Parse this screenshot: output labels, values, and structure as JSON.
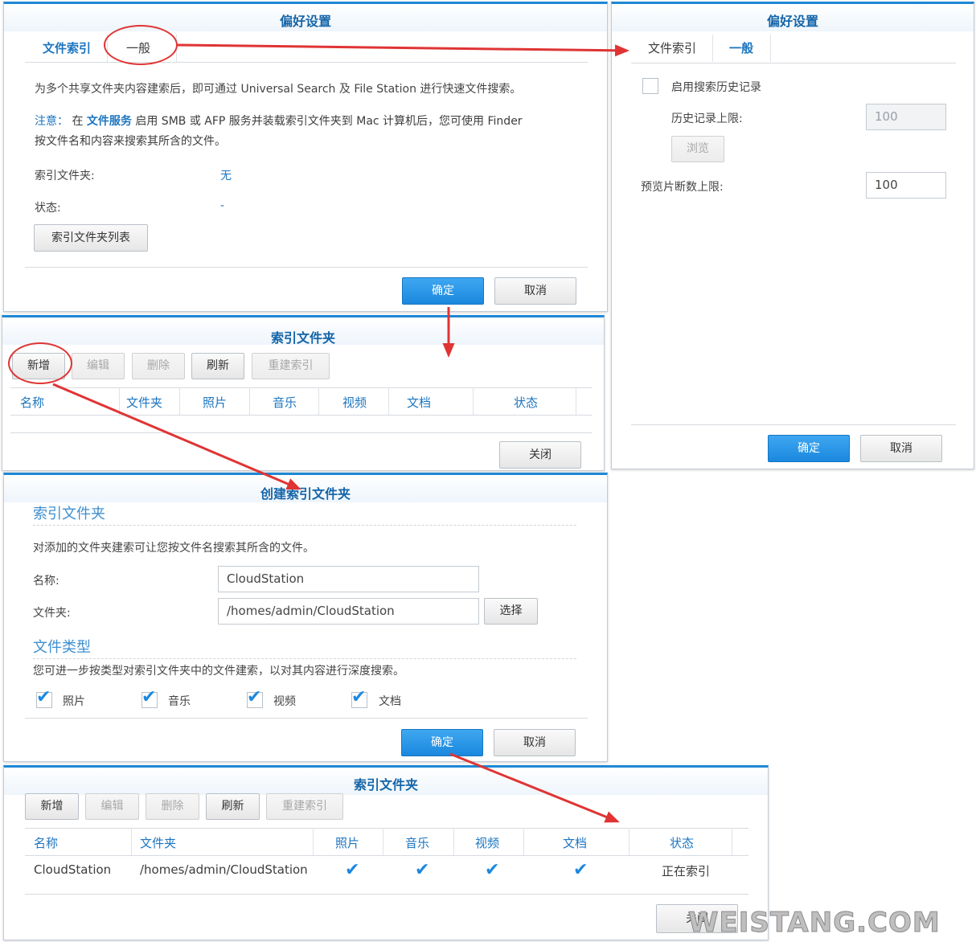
{
  "pref_window": {
    "title": "偏好设置",
    "tabs": [
      "文件索引",
      "一般"
    ],
    "intro": "为多个共享文件夹内容建索后，即可通过 Universal Search 及 File Station 进行快速文件搜索。",
    "note_label": "注意：",
    "note_in": "在",
    "note_link": "文件服务",
    "note_text1": "启用 SMB 或 AFP 服务并装载索引文件夹到 Mac 计算机后，您可使用 Finder",
    "note_text2": "按文件名和内容来搜索其所含的文件。",
    "index_folder_label": "索引文件夹:",
    "index_folder_value": "无",
    "status_label": "状态:",
    "status_value": "-",
    "list_button": "索引文件夹列表",
    "ok": "确定",
    "cancel": "取消"
  },
  "general_window": {
    "title": "偏好设置",
    "tabs": [
      "文件索引",
      "一般"
    ],
    "enable_history": "启用搜索历史记录",
    "history_limit_label": "历史记录上限:",
    "history_limit_value": "100",
    "browse": "浏览",
    "preview_limit_label": "预览片断数上限:",
    "preview_limit_value": "100",
    "ok": "确定",
    "cancel": "取消"
  },
  "index_window_empty": {
    "title": "索引文件夹",
    "toolbar": [
      "新增",
      "编辑",
      "删除",
      "刷新",
      "重建索引"
    ],
    "columns": [
      "名称",
      "文件夹",
      "照片",
      "音乐",
      "视频",
      "文档",
      "状态"
    ],
    "close": "关闭"
  },
  "create_window": {
    "title": "创建索引文件夹",
    "section1": "索引文件夹",
    "desc1": "对添加的文件夹建索可让您按文件名搜索其所含的文件。",
    "name_label": "名称:",
    "name_value": "CloudStation",
    "folder_label": "文件夹:",
    "folder_value": "/homes/admin/CloudStation",
    "select": "选择",
    "section2": "文件类型",
    "desc2": "您可进一步按类型对索引文件夹中的文件建索，以对其内容进行深度搜索。",
    "types": [
      "照片",
      "音乐",
      "视频",
      "文档"
    ],
    "ok": "确定",
    "cancel": "取消"
  },
  "index_window_full": {
    "title": "索引文件夹",
    "toolbar": [
      "新增",
      "编辑",
      "删除",
      "刷新",
      "重建索引"
    ],
    "columns": [
      "名称",
      "文件夹",
      "照片",
      "音乐",
      "视频",
      "文档",
      "状态"
    ],
    "row": {
      "name": "CloudStation",
      "folder": "/homes/admin/CloudStation",
      "status": "正在索引"
    },
    "close": "关闭"
  },
  "watermark": "WEISTANG.COM",
  "colors": {
    "accent": "#1e88d6",
    "annotation": "#e03434"
  }
}
